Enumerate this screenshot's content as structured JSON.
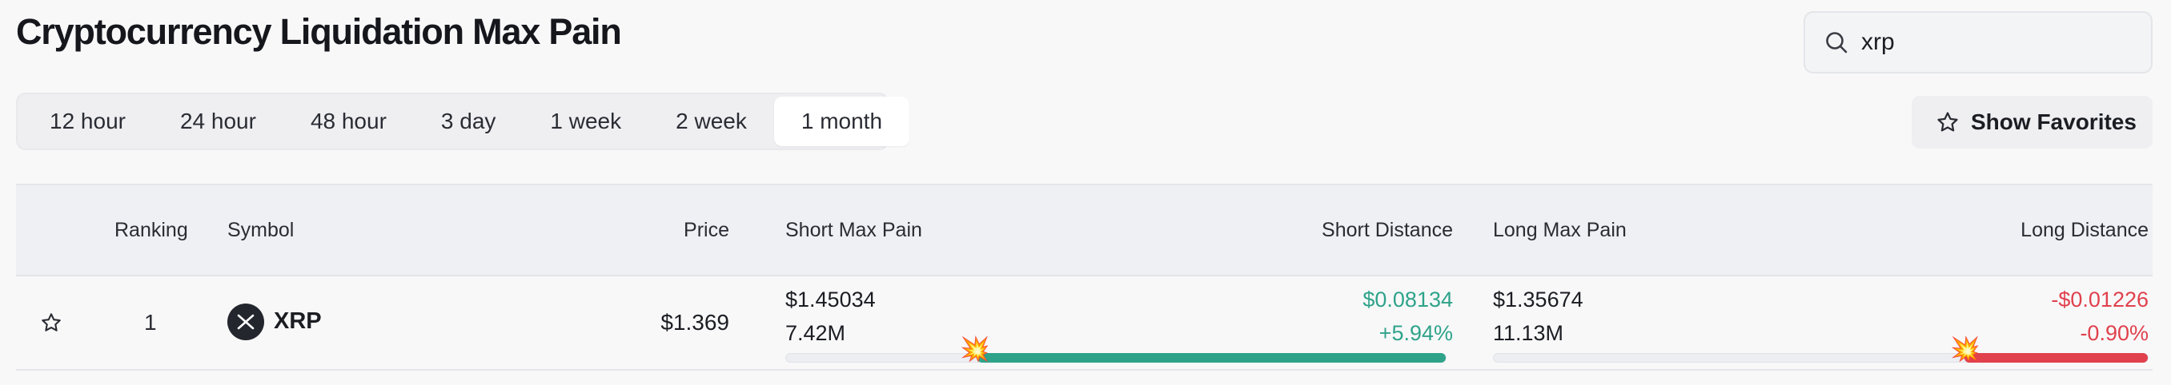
{
  "page": {
    "title": "Cryptocurrency Liquidation Max Pain"
  },
  "search": {
    "value": "xrp",
    "icon": "search-icon"
  },
  "timeframes": [
    {
      "label": "12 hour",
      "active": false
    },
    {
      "label": "24 hour",
      "active": false
    },
    {
      "label": "48 hour",
      "active": false
    },
    {
      "label": "3 day",
      "active": false
    },
    {
      "label": "1 week",
      "active": false
    },
    {
      "label": "2 week",
      "active": false
    },
    {
      "label": "1 month",
      "active": true
    }
  ],
  "favorites_button": {
    "label": "Show Favorites",
    "icon": "star-icon"
  },
  "table": {
    "columns": {
      "ranking": "Ranking",
      "symbol": "Symbol",
      "price": "Price",
      "short_max_pain": "Short Max Pain",
      "short_distance": "Short Distance",
      "long_max_pain": "Long Max Pain",
      "long_distance": "Long Distance"
    },
    "rows": [
      {
        "rank": "1",
        "symbol": "XRP",
        "price": "$1.369",
        "short_price": "$1.45034",
        "short_amount": "7.42M",
        "short_distance": "$0.08134",
        "short_distance_pct": "+5.94%",
        "short_bar_fraction": 0.71,
        "long_price": "$1.35674",
        "long_amount": "11.13M",
        "long_distance": "-$0.01226",
        "long_distance_pct": "-0.90%",
        "long_bar_fraction": 0.28
      }
    ]
  },
  "colors": {
    "positive": "#2fa38a",
    "negative": "#e0414d",
    "bar_track": "#eceef2",
    "active_tab": "#ffffff"
  }
}
